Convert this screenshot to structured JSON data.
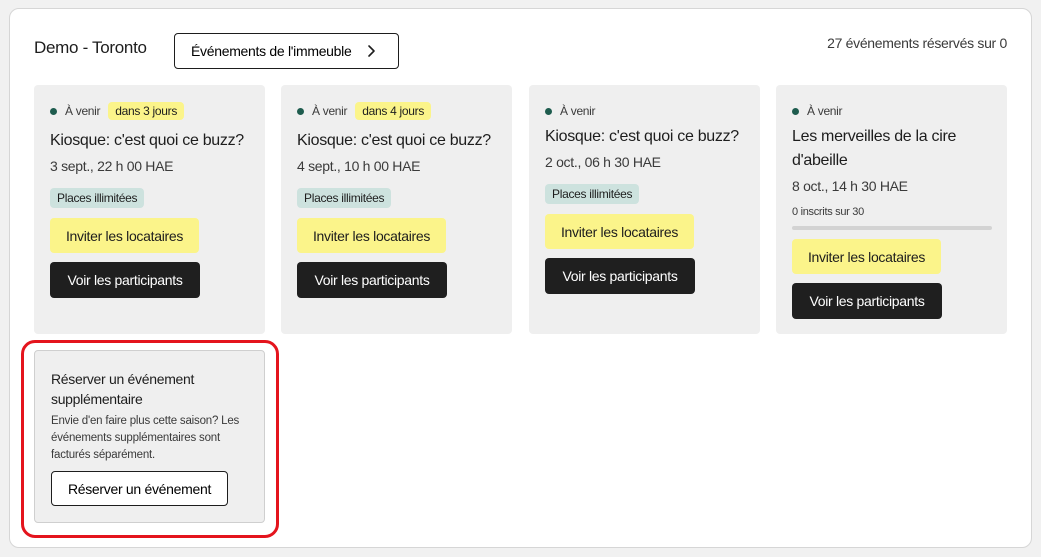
{
  "header": {
    "title": "Demo - Toronto",
    "building_events_label": "Événements de l'immeuble",
    "counter": "27 événements réservés sur 0"
  },
  "events": [
    {
      "status": "À venir",
      "days_badge": "dans 3 jours",
      "title": "Kiosque: c'est quoi ce buzz?",
      "date": "3 sept., 22 h 00 HAE",
      "places": "Places illimitées",
      "invite_label": "Inviter les locataires",
      "view_label": "Voir les participants"
    },
    {
      "status": "À venir",
      "days_badge": "dans 4 jours",
      "title": "Kiosque: c'est quoi ce buzz?",
      "date": "4 sept., 10 h 00 HAE",
      "places": "Places illimitées",
      "invite_label": "Inviter les locataires",
      "view_label": "Voir les participants"
    },
    {
      "status": "À venir",
      "title": "Kiosque: c'est quoi ce buzz?",
      "date": "2 oct., 06 h 30 HAE",
      "places": "Places illimitées",
      "invite_label": "Inviter les locataires",
      "view_label": "Voir les participants"
    },
    {
      "status": "À venir",
      "title": "Les merveilles de la cire d'abeille",
      "date": "8 oct., 14 h 30 HAE",
      "registered": "0 inscrits sur 30",
      "registered_fraction": 0,
      "invite_label": "Inviter les locataires",
      "view_label": "Voir les participants"
    }
  ],
  "extra": {
    "title": "Réserver un événement supplémentaire",
    "description": "Envie d'en faire plus cette saison? Les événements supplémentaires sont facturés séparément.",
    "button_label": "Réserver un événement"
  },
  "colors": {
    "status_dot": "#1e5c4e",
    "yellow_accent": "#fbf48a",
    "places_badge": "#cde2de",
    "highlight_ring": "#e4141d"
  }
}
